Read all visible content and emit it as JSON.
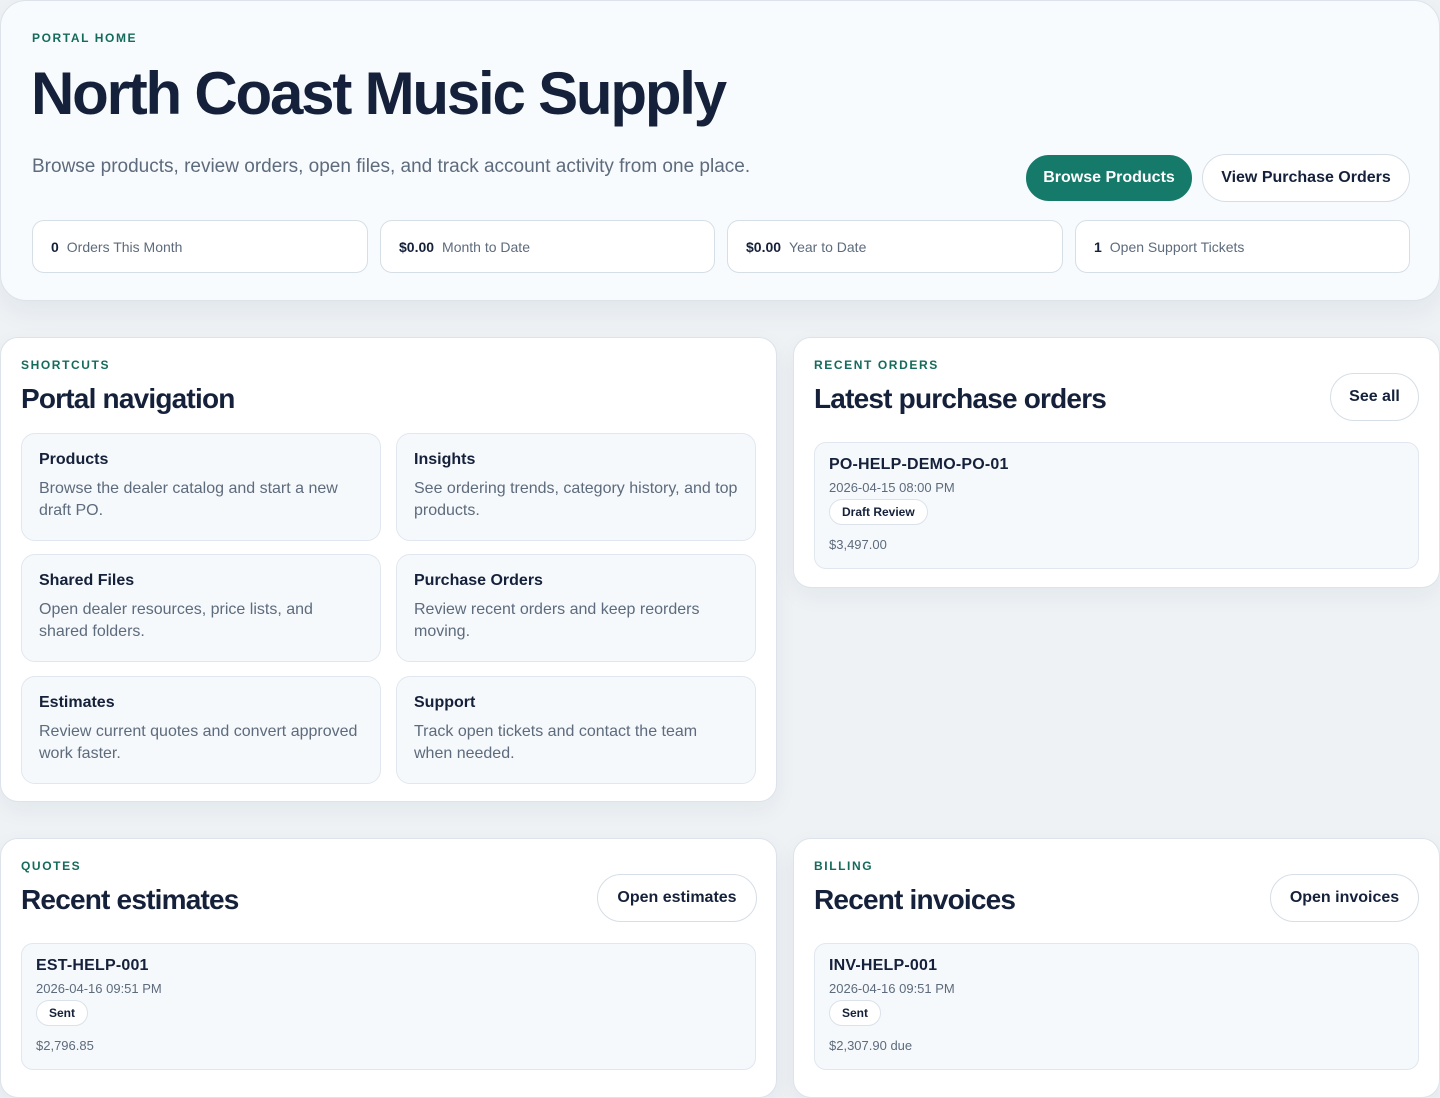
{
  "hero": {
    "eyebrow": "PORTAL HOME",
    "title": "North Coast Music Supply",
    "subtitle": "Browse products, review orders, open files, and track account activity from one place.",
    "primary_button": "Browse Products",
    "secondary_button": "View Purchase Orders",
    "stats": [
      {
        "value": "0",
        "label": "Orders This Month"
      },
      {
        "value": "$0.00",
        "label": "Month to Date"
      },
      {
        "value": "$0.00",
        "label": "Year to Date"
      },
      {
        "value": "1",
        "label": "Open Support Tickets"
      }
    ]
  },
  "shortcuts": {
    "eyebrow": "SHORTCUTS",
    "title": "Portal navigation",
    "items": [
      {
        "title": "Products",
        "desc": "Browse the dealer catalog and start a new draft PO."
      },
      {
        "title": "Insights",
        "desc": "See ordering trends, category history, and top products."
      },
      {
        "title": "Shared Files",
        "desc": "Open dealer resources, price lists, and shared folders."
      },
      {
        "title": "Purchase Orders",
        "desc": "Review recent orders and keep reorders moving."
      },
      {
        "title": "Estimates",
        "desc": "Review current quotes and convert approved work faster."
      },
      {
        "title": "Support",
        "desc": "Track open tickets and contact the team when needed."
      }
    ]
  },
  "recent_orders": {
    "eyebrow": "RECENT ORDERS",
    "title": "Latest purchase orders",
    "button": "See all",
    "items": [
      {
        "id": "PO-HELP-DEMO-PO-01",
        "date": "2026-04-15 08:00 PM",
        "status": "Draft Review",
        "amount": "$3,497.00"
      }
    ]
  },
  "quotes": {
    "eyebrow": "QUOTES",
    "title": "Recent estimates",
    "button": "Open estimates",
    "items": [
      {
        "id": "EST-HELP-001",
        "date": "2026-04-16 09:51 PM",
        "status": "Sent",
        "amount": "$2,796.85"
      }
    ]
  },
  "billing": {
    "eyebrow": "BILLING",
    "title": "Recent invoices",
    "button": "Open invoices",
    "items": [
      {
        "id": "INV-HELP-001",
        "date": "2026-04-16 09:51 PM",
        "status": "Sent",
        "amount": "$2,307.90 due"
      }
    ]
  },
  "colors": {
    "accent": "#157a6a",
    "eyebrow": "#146b5c",
    "heading": "#15213a",
    "muted": "#5d6b7c",
    "background": "#eef2f5"
  }
}
